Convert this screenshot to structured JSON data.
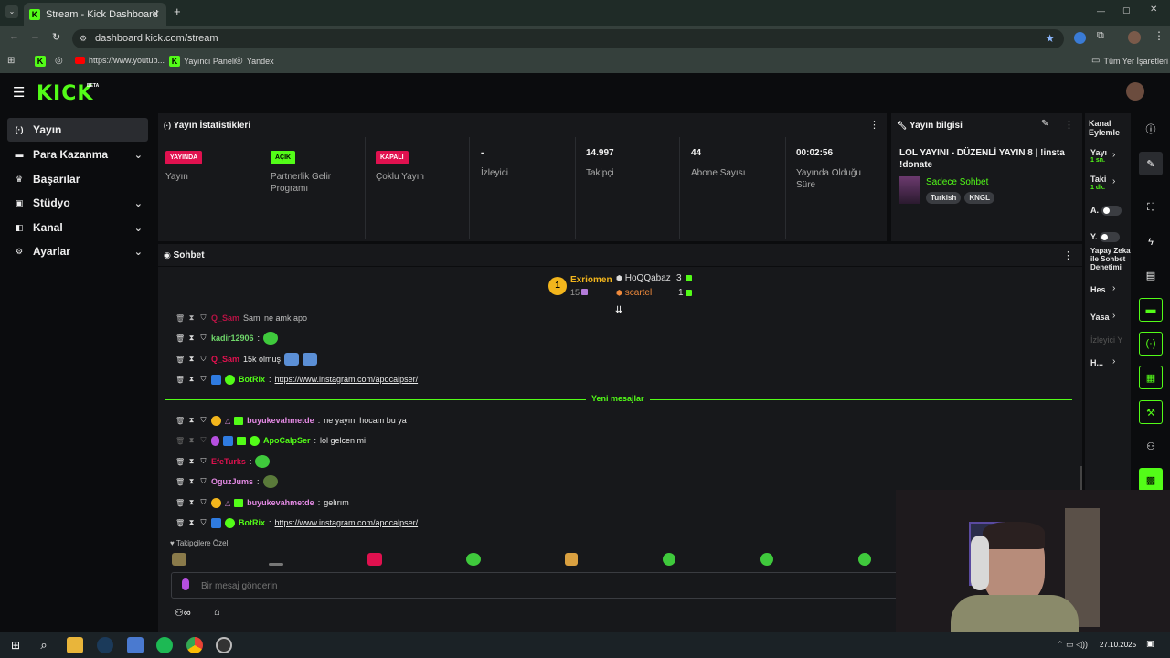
{
  "browser": {
    "tab_title": "Stream - Kick Dashboard",
    "url": "dashboard.kick.com/stream",
    "bookmarks": [
      "https://www.youtub...",
      "Yayıncı Paneli",
      "Yandex"
    ],
    "all_bookmarks": "Tüm Yer İşaretleri"
  },
  "brand": {
    "logo": "KICK",
    "beta": "BETA",
    "accent": "#53fc18"
  },
  "sidebar": {
    "items": [
      {
        "label": "Yayın",
        "icon": "broadcast-icon"
      },
      {
        "label": "Para Kazanma",
        "icon": "money-icon"
      },
      {
        "label": "Başarılar",
        "icon": "trophy-icon"
      },
      {
        "label": "Stüdyo",
        "icon": "studio-icon"
      },
      {
        "label": "Kanal",
        "icon": "channel-icon"
      },
      {
        "label": "Ayarlar",
        "icon": "gear-icon"
      }
    ]
  },
  "stats": {
    "title": "Yayın İstatistikleri",
    "cells": [
      {
        "badge": "YAYINDA",
        "label": "Yayın"
      },
      {
        "badge": "AÇIK",
        "label": "Partnerlik Gelir Programı"
      },
      {
        "badge": "KAPALI",
        "label": "Çoklu Yayın"
      },
      {
        "value": "-",
        "label": "İzleyici"
      },
      {
        "value": "14.997",
        "label": "Takipçi"
      },
      {
        "value": "44",
        "label": "Abone Sayısı"
      },
      {
        "value": "00:02:56",
        "label": "Yayında Olduğu Süre"
      }
    ]
  },
  "info": {
    "title": "Yayın bilgisi",
    "stream_title": "LOL YAYINI - DÜZENLİ YAYIN 8 | !insta !donate",
    "category": "Sadece Sohbet",
    "tags": [
      "Turkish",
      "KNGL"
    ]
  },
  "kanal": {
    "title": "Kanal Eylemle",
    "items": [
      "Yayı",
      "1 sn.",
      "Taki",
      "1 dk.",
      "A.",
      "Y.",
      "Yapay Zeka ile Sohbet Denetimi",
      "Hes",
      "Yasa",
      "İzleyici Y",
      "H..."
    ]
  },
  "chat": {
    "title": "Sohbet",
    "leaderboard": {
      "top": {
        "name": "Exriomen",
        "rank": "1",
        "count": "15"
      },
      "others": [
        {
          "name": "HoQQabaz",
          "count": "3"
        },
        {
          "name": "scartel",
          "count": "1"
        }
      ]
    },
    "new_messages": "Yeni mesajlar",
    "messages": [
      {
        "user": "Q_Sam",
        "text": "Sami ne amk apo"
      },
      {
        "user": "kadir12906",
        "text": ""
      },
      {
        "user": "Q_Sam",
        "text": "15k olmuş"
      },
      {
        "user": "BotRix",
        "text": "https://www.instagram.com/apocalpser/"
      },
      {
        "user": "buyukevahmetde",
        "text": "ne yayını hocam bu ya"
      },
      {
        "user": "ApoCalpSer",
        "text": "lol gelcen mi"
      },
      {
        "user": "EfeTurks",
        "text": ""
      },
      {
        "user": "OguzJums",
        "text": ""
      },
      {
        "user": "buyukevahmetde",
        "text": "gelırım"
      },
      {
        "user": "BotRix",
        "text": "https://www.instagram.com/apocalpser/"
      }
    ],
    "followers_only": "Takipçilere Özel",
    "placeholder": "Bir mesaj gönderin",
    "bottom_text": "∞"
  },
  "taskbar": {
    "date": "27.10.2025"
  }
}
